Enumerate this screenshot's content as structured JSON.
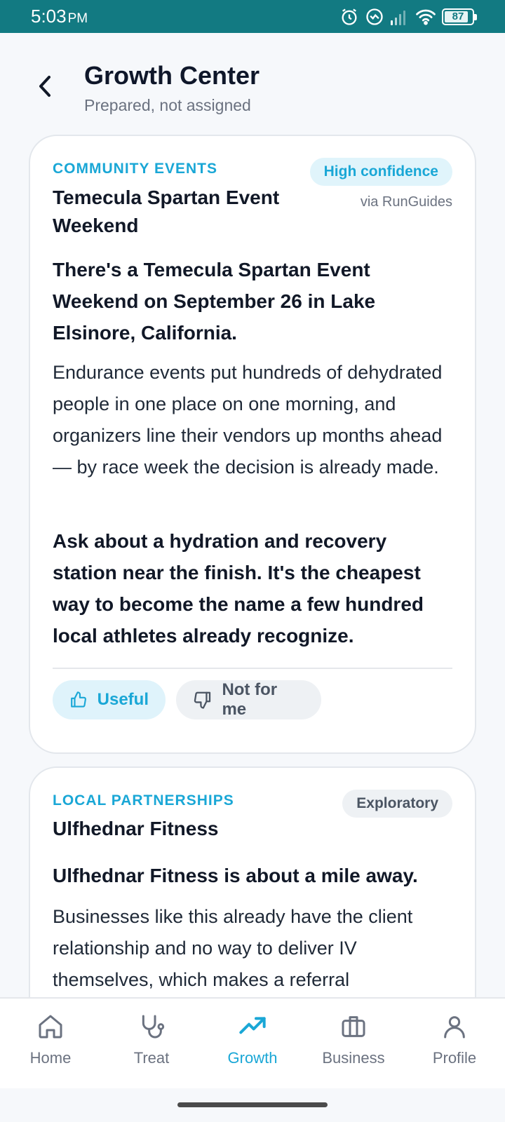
{
  "status_bar": {
    "time": "5:03",
    "ampm": "PM",
    "battery": "87",
    "battery_level": 0.87,
    "icons": [
      "alarm-icon",
      "sync-icon",
      "signal-icon",
      "wifi-icon",
      "battery-icon"
    ]
  },
  "header": {
    "title": "Growth Center",
    "subtitle": "Prepared, not assigned",
    "back_icon": "chevron-left-icon"
  },
  "cards": [
    {
      "category": "COMMUNITY EVENTS",
      "title": "Temecula Spartan Event Weekend",
      "confidence": "High confidence",
      "source": "via RunGuides",
      "headline": "There's a Temecula Spartan Event Weekend on September 26 in Lake Elsinore, California.",
      "body": "Endurance events put hundreds of dehydrated people in one place on one morning, and organizers line their vendors up months ahead — by race week the decision is already made.",
      "action": "Ask about a hydration and recovery station near the finish. It's the cheapest way to become the name a few hundred local athletes already recognize.",
      "useful_label": "Useful",
      "not_label": "Not for me"
    },
    {
      "category": "LOCAL PARTNERSHIPS",
      "title": "Ulfhednar Fitness",
      "confidence": "Exploratory",
      "headline": "Ulfhednar Fitness is about a mile away.",
      "body": "Businesses like this already have the client relationship and no way to deliver IV themselves, which makes a referral"
    }
  ],
  "nav": {
    "items": [
      {
        "label": "Home",
        "icon": "home-icon"
      },
      {
        "label": "Treat",
        "icon": "stethoscope-icon"
      },
      {
        "label": "Growth",
        "icon": "trending-up-icon",
        "active": true
      },
      {
        "label": "Business",
        "icon": "briefcase-icon"
      },
      {
        "label": "Profile",
        "icon": "user-icon"
      }
    ]
  },
  "colors": {
    "status_bar": "#127a82",
    "accent": "#1aa7d6",
    "background": "#f6f8fb"
  }
}
